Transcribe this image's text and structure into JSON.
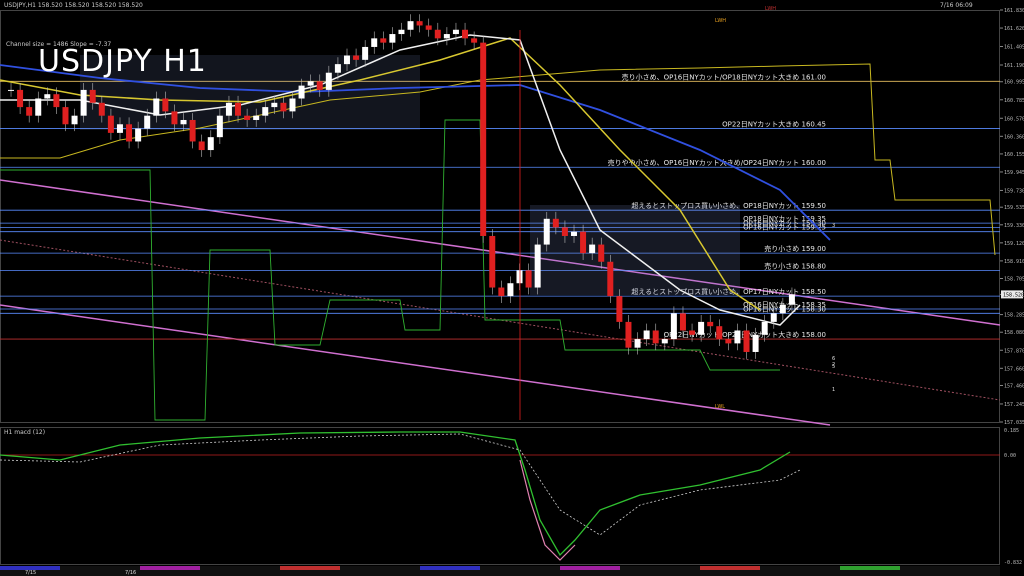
{
  "header": {
    "symbol_line": "USDJPY,H1  158.520 158.520 158.520 158.520",
    "indicator_line": "Channel size = 1486 Slope = -7.37",
    "clock": "7/16 06:09",
    "macd_label": "H1  macd (12)"
  },
  "title": "USDJPY H1",
  "chart_data": {
    "type": "line",
    "title": "USDJPY H1",
    "price_range": [
      157.035,
      161.83
    ],
    "price_ticks": [
      "161.830",
      "161.620",
      "161.405",
      "161.190",
      "160.995",
      "160.785",
      "160.570",
      "160.360",
      "160.155",
      "159.945",
      "159.730",
      "159.535",
      "159.330",
      "159.120",
      "158.910",
      "158.705",
      "158.520",
      "158.285",
      "158.080",
      "157.870",
      "157.660",
      "157.460",
      "157.245",
      "157.035"
    ],
    "current_price": "158.520",
    "levels": [
      {
        "label": "売り小さめ、OP16日NYカット/OP18日NYカット大きめ 161.00",
        "price": 161.0,
        "color": "#e8c060"
      },
      {
        "label": "OP22日NYカット大きめ 160.45",
        "price": 160.45,
        "color": "#5a8cff"
      },
      {
        "label": "売りやや小さめ、OP16日NYカット大きめ/OP24日NYカット 160.00",
        "price": 160.0,
        "color": "#5a8cff"
      },
      {
        "label": "超えるとストップロス買い小さめ、OP18日NYカット 159.50",
        "price": 159.5,
        "color": "#5a8cff"
      },
      {
        "label": "OP18日NYカット 159.35",
        "price": 159.35,
        "color": "#5a8cff"
      },
      {
        "label": "OP16日NYカット 159.30",
        "price": 159.3,
        "color": "#5a8cff"
      },
      {
        "label": "OP16日NYカット 159.25",
        "price": 159.25,
        "color": "#5a8cff"
      },
      {
        "label": "売り小さめ 159.00",
        "price": 159.0,
        "color": "#5a8cff"
      },
      {
        "label": "売り小さめ 158.80",
        "price": 158.8,
        "color": "#5a8cff"
      },
      {
        "label": "超えるとストップロス買い小さめ、OP17日NYカット 158.50",
        "price": 158.5,
        "color": "#5a8cff"
      },
      {
        "label": "OP16日NYカット 158.35",
        "price": 158.35,
        "color": "#5a8cff"
      },
      {
        "label": "OP16日NYカット 158.30",
        "price": 158.3,
        "color": "#5a8cff"
      },
      {
        "label": "OP22日NYカット/OP23日NYカット大きめ 158.00",
        "price": 158.0,
        "color": "#c03030"
      }
    ],
    "candles_close": [
      160.9,
      160.7,
      160.6,
      160.8,
      160.85,
      160.7,
      160.5,
      160.6,
      160.9,
      160.75,
      160.6,
      160.4,
      160.5,
      160.3,
      160.45,
      160.6,
      160.8,
      160.65,
      160.5,
      160.55,
      160.3,
      160.2,
      160.35,
      160.6,
      160.75,
      160.6,
      160.55,
      160.6,
      160.7,
      160.75,
      160.65,
      160.8,
      160.95,
      161.0,
      160.9,
      161.1,
      161.2,
      161.3,
      161.25,
      161.4,
      161.5,
      161.45,
      161.55,
      161.6,
      161.7,
      161.65,
      161.6,
      161.5,
      161.55,
      161.6,
      161.5,
      161.45,
      159.2,
      158.6,
      158.5,
      158.65,
      158.8,
      158.6,
      159.1,
      159.4,
      159.3,
      159.2,
      159.25,
      159.0,
      159.1,
      158.9,
      158.5,
      158.2,
      157.9,
      158.0,
      158.1,
      157.95,
      158.0,
      158.3,
      158.1,
      158.05,
      158.2,
      158.15,
      158.0,
      157.95,
      158.1,
      157.85,
      158.05,
      158.2,
      158.3,
      158.4,
      158.52
    ],
    "macd_ticks": [
      "0.185",
      "0.00",
      "-0.832"
    ],
    "date_ticks": [
      "7/15",
      "7/16"
    ],
    "markers": [
      {
        "text": "LWH",
        "color": "#e8a020"
      },
      {
        "text": "LWH",
        "color": "#c03030"
      },
      {
        "text": "LWL",
        "color": "#e8a020"
      },
      {
        "text": "1",
        "color": "#e0e0e0"
      },
      {
        "text": "3",
        "color": "#e0e0e0"
      },
      {
        "text": "6",
        "color": "#e0e0e0"
      },
      {
        "text": "5",
        "color": "#e0e0e0"
      },
      {
        "text": "2",
        "color": "#e0e0e0"
      }
    ]
  }
}
